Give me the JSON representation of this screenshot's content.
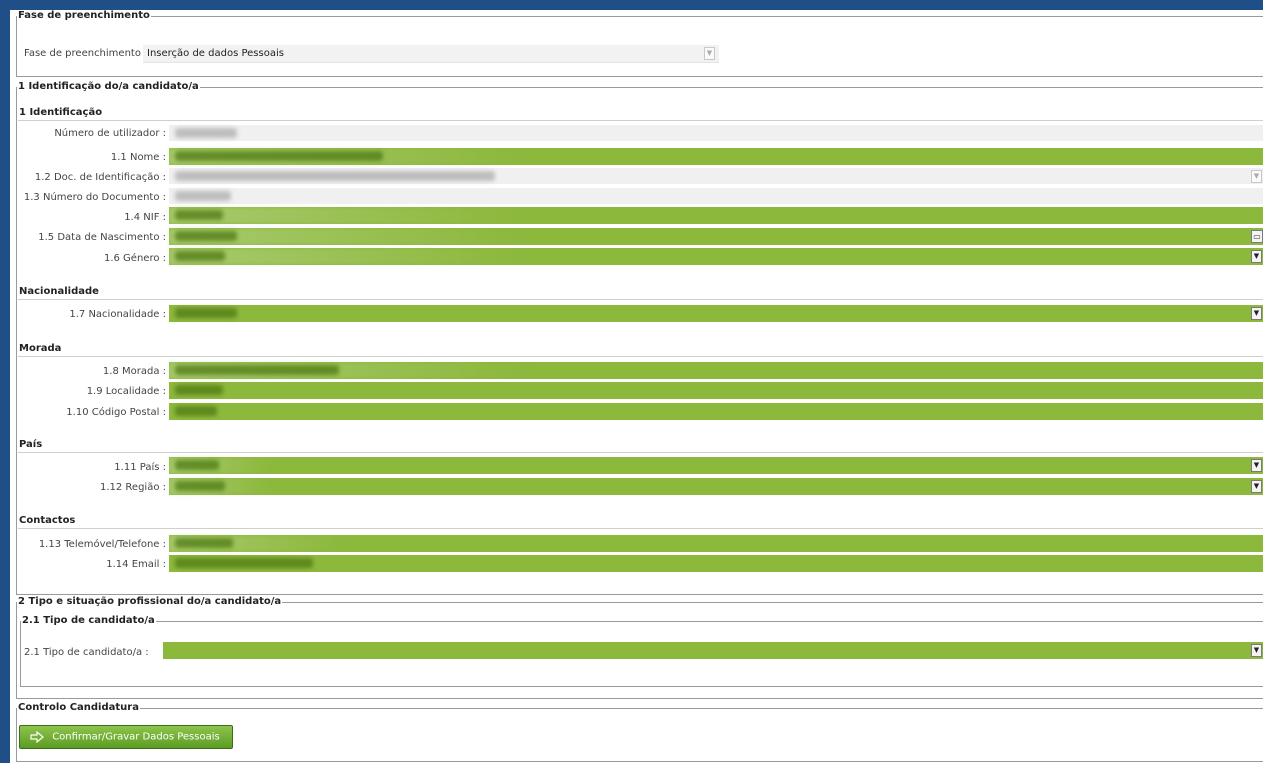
{
  "fase": {
    "legend": "Fase de preenchimento",
    "label": "Fase de preenchimento :",
    "value": "Inserção de dados Pessoais"
  },
  "section1": {
    "legend": "1 Identificação do/a candidato/a",
    "identificacao": {
      "title": "1 Identificação",
      "fields": [
        {
          "label": "Número de utilizador :"
        },
        {
          "label": "1.1 Nome :"
        },
        {
          "label": "1.2 Doc. de Identificação :"
        },
        {
          "label": "1.3 Número do Documento :"
        },
        {
          "label": "1.4 NIF :"
        },
        {
          "label": "1.5 Data de Nascimento :"
        },
        {
          "label": "1.6 Género :"
        }
      ]
    },
    "nacionalidade": {
      "title": "Nacionalidade",
      "fields": [
        {
          "label": "1.7 Nacionalidade :"
        }
      ]
    },
    "morada": {
      "title": "Morada",
      "fields": [
        {
          "label": "1.8 Morada :"
        },
        {
          "label": "1.9 Localidade :"
        },
        {
          "label": "1.10 Código Postal :"
        }
      ]
    },
    "pais": {
      "title": "País",
      "fields": [
        {
          "label": "1.11 País :"
        },
        {
          "label": "1.12 Região :"
        }
      ]
    },
    "contactos": {
      "title": "Contactos",
      "fields": [
        {
          "label": "1.13 Telemóvel/Telefone :"
        },
        {
          "label": "1.14 Email :"
        }
      ]
    }
  },
  "section2": {
    "legend": "2 Tipo e situação profissional do/a candidato/a",
    "sub_legend": "2.1 Tipo de candidato/a",
    "label": "2.1 Tipo de candidato/a :"
  },
  "controlo": {
    "legend": "Controlo Candidatura",
    "confirm_label": "Confirmar/Gravar Dados Pessoais"
  },
  "colors": {
    "frame": "#1f4f86",
    "field_green": "#8cb83c",
    "field_grey": "#f0f0f0",
    "button_green": "#6aaa2c"
  }
}
